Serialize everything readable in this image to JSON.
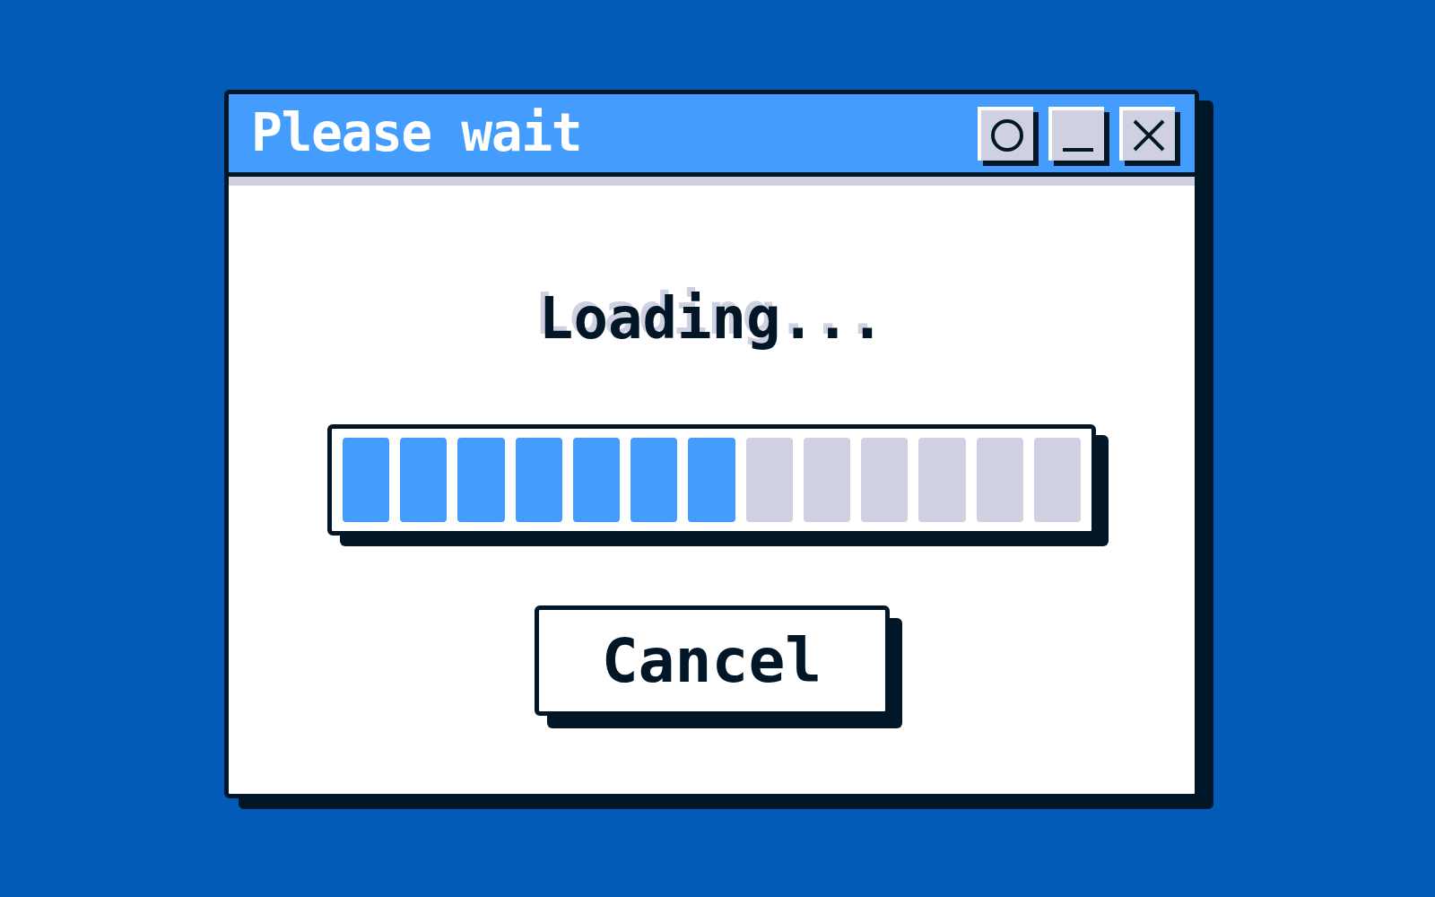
{
  "window": {
    "title": "Please wait"
  },
  "message": "Loading...",
  "progress": {
    "level": 0.538
  },
  "buttons": [
    "Cancel"
  ]
}
